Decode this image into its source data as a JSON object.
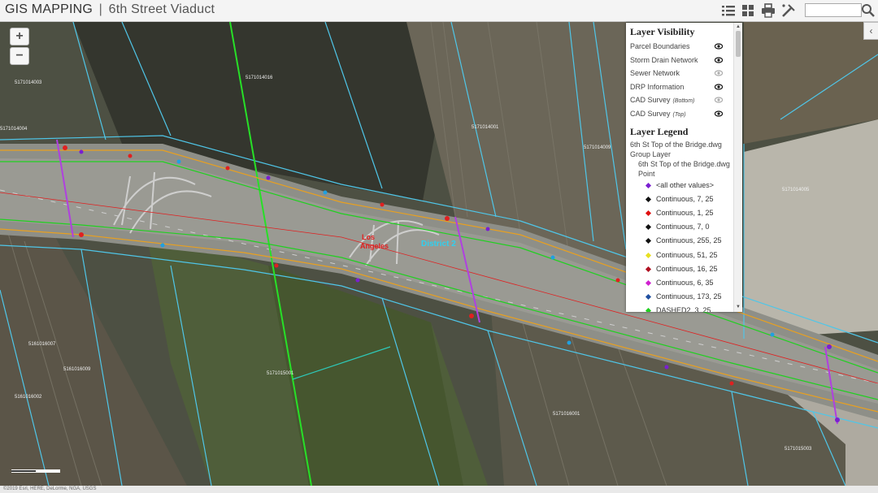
{
  "app": {
    "title": "GIS MAPPING",
    "separator": "|",
    "subtitle": "6th Street Viaduct"
  },
  "toolbar": {
    "icons": [
      "list-icon",
      "grid-icon",
      "print-icon",
      "measure-tool-icon",
      "search-icon"
    ],
    "search_placeholder": ""
  },
  "map": {
    "zoom_in": "+",
    "zoom_out": "−",
    "labels": {
      "district": "District 2",
      "los": "Los",
      "angeles": "Angeles",
      "parcel_1": "5171014003",
      "parcel_2": "5171014004",
      "parcel_3": "5171014016",
      "parcel_4": "5171014001",
      "parcel_5": "5171014009",
      "parcel_6": "5171014005",
      "parcel_7": "5161016007",
      "parcel_8": "5161016009",
      "parcel_9": "5171015001",
      "parcel_10": "5171016001",
      "parcel_11": "5161016002",
      "parcel_12": "5171015003"
    }
  },
  "panel": {
    "visibility_heading": "Layer Visibility",
    "layers": [
      {
        "label": "Parcel Boundaries",
        "note": "",
        "visible": true
      },
      {
        "label": "Storm Drain Network",
        "note": "",
        "visible": true
      },
      {
        "label": "Sewer Network",
        "note": "",
        "visible": false
      },
      {
        "label": "DRP Information",
        "note": "",
        "visible": true
      },
      {
        "label": "CAD Survey",
        "note": "(Bottom)",
        "visible": false
      },
      {
        "label": "CAD Survey",
        "note": "(Top)",
        "visible": true
      }
    ],
    "legend_heading": "Layer Legend",
    "legend_group": "6th St Top of the Bridge.dwg",
    "legend_group_type": "Group Layer",
    "legend_layer": "6th St Top of the Bridge.dwg Point",
    "legend_items": [
      {
        "label": "<all other values>",
        "color": "#7a1fd1"
      },
      {
        "label": "Continuous, 7, 25",
        "color": "#111111"
      },
      {
        "label": "Continuous, 1, 25",
        "color": "#e01010"
      },
      {
        "label": "Continuous, 7, 0",
        "color": "#111111"
      },
      {
        "label": "Continuous, 255, 25",
        "color": "#111111"
      },
      {
        "label": "Continuous, 51, 25",
        "color": "#e8e020"
      },
      {
        "label": "Continuous, 16, 25",
        "color": "#b01020"
      },
      {
        "label": "Continuous, 6, 35",
        "color": "#d020d0"
      },
      {
        "label": "Continuous, 173, 25",
        "color": "#2050a0"
      },
      {
        "label": "DASHED2, 3, 25",
        "color": "#20d020"
      }
    ],
    "collapse_arrow": "‹"
  },
  "footer": {
    "text": "©2019 Esri, HERE, DeLorme, NGA, USGS"
  }
}
